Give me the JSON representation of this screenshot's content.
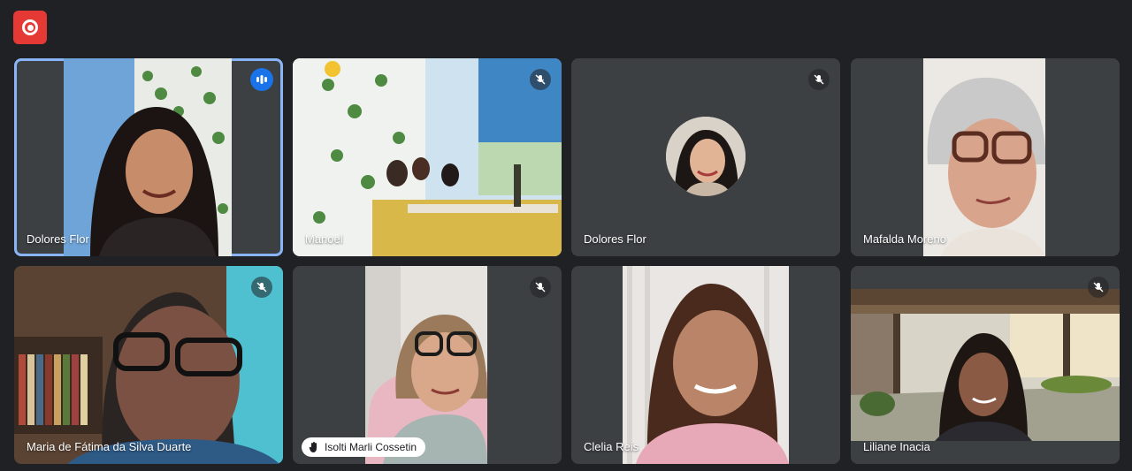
{
  "meeting": {
    "record_icon": "record-icon"
  },
  "participants": [
    {
      "name": "Dolores Flor",
      "status_icon": "speaking-indicator-icon"
    },
    {
      "name": "Manoel",
      "status_icon": "mic-off-icon"
    },
    {
      "name": "Dolores Flor",
      "status_icon": "mic-off-icon"
    },
    {
      "name": "Mafalda Moreno",
      "status_icon": ""
    },
    {
      "name": "Maria de Fátima da Silva Duarte",
      "status_icon": "mic-off-icon"
    },
    {
      "name": "Isolti Marli Cossetin",
      "status_icon": "mic-off-icon"
    },
    {
      "name": "Clelia Reis",
      "status_icon": ""
    },
    {
      "name": "Liliane Inacia",
      "status_icon": "mic-off-icon"
    }
  ],
  "colors": {
    "background": "#202124",
    "tile": "#3c4043",
    "active_outline": "#8ab4f8",
    "record": "#e53935",
    "speaking": "#1a73e8"
  }
}
